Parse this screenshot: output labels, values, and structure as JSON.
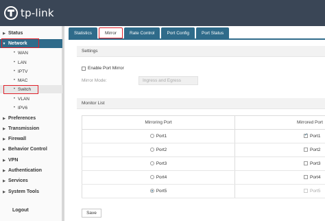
{
  "brand": {
    "name": "tp-link"
  },
  "sidebar": {
    "items": [
      {
        "label": "Status"
      },
      {
        "label": "Network"
      },
      {
        "label": "Preferences"
      },
      {
        "label": "Transmission"
      },
      {
        "label": "Firewall"
      },
      {
        "label": "Behavior Control"
      },
      {
        "label": "VPN"
      },
      {
        "label": "Authentication"
      },
      {
        "label": "Services"
      },
      {
        "label": "System Tools"
      },
      {
        "label": "Logout"
      }
    ],
    "network_sub": [
      {
        "label": "WAN"
      },
      {
        "label": "LAN"
      },
      {
        "label": "IPTV"
      },
      {
        "label": "MAC"
      },
      {
        "label": "Switch"
      },
      {
        "label": "VLAN"
      },
      {
        "label": "IPV6"
      }
    ]
  },
  "tabs": [
    {
      "label": "Statistics"
    },
    {
      "label": "Mirror"
    },
    {
      "label": "Rate Control"
    },
    {
      "label": "Port Config"
    },
    {
      "label": "Port Status"
    }
  ],
  "settings": {
    "heading": "Settings",
    "enable_label": "Enable Port Mirror",
    "mode_label": "Mirror Mode:",
    "mode_value": "Ingress and Egress"
  },
  "monitor": {
    "heading": "Monitor List",
    "col1": "Mirroring Port",
    "col2": "Mirrored Port",
    "rows": [
      {
        "mirroring": "Port1",
        "mirrored": "Port1",
        "mirroring_selected": false,
        "mirrored_checked": true,
        "mirrored_disabled": false
      },
      {
        "mirroring": "Port2",
        "mirrored": "Port2",
        "mirroring_selected": false,
        "mirrored_checked": false,
        "mirrored_disabled": false
      },
      {
        "mirroring": "Port3",
        "mirrored": "Port3",
        "mirroring_selected": false,
        "mirrored_checked": false,
        "mirrored_disabled": false
      },
      {
        "mirroring": "Port4",
        "mirrored": "Port4",
        "mirroring_selected": false,
        "mirrored_checked": false,
        "mirrored_disabled": false
      },
      {
        "mirroring": "Port5",
        "mirrored": "Port5",
        "mirroring_selected": true,
        "mirrored_checked": false,
        "mirrored_disabled": true
      }
    ]
  },
  "save_label": "Save",
  "colors": {
    "header": "#3a4656",
    "accent": "#2f6b8a",
    "highlight": "#e0202a"
  }
}
